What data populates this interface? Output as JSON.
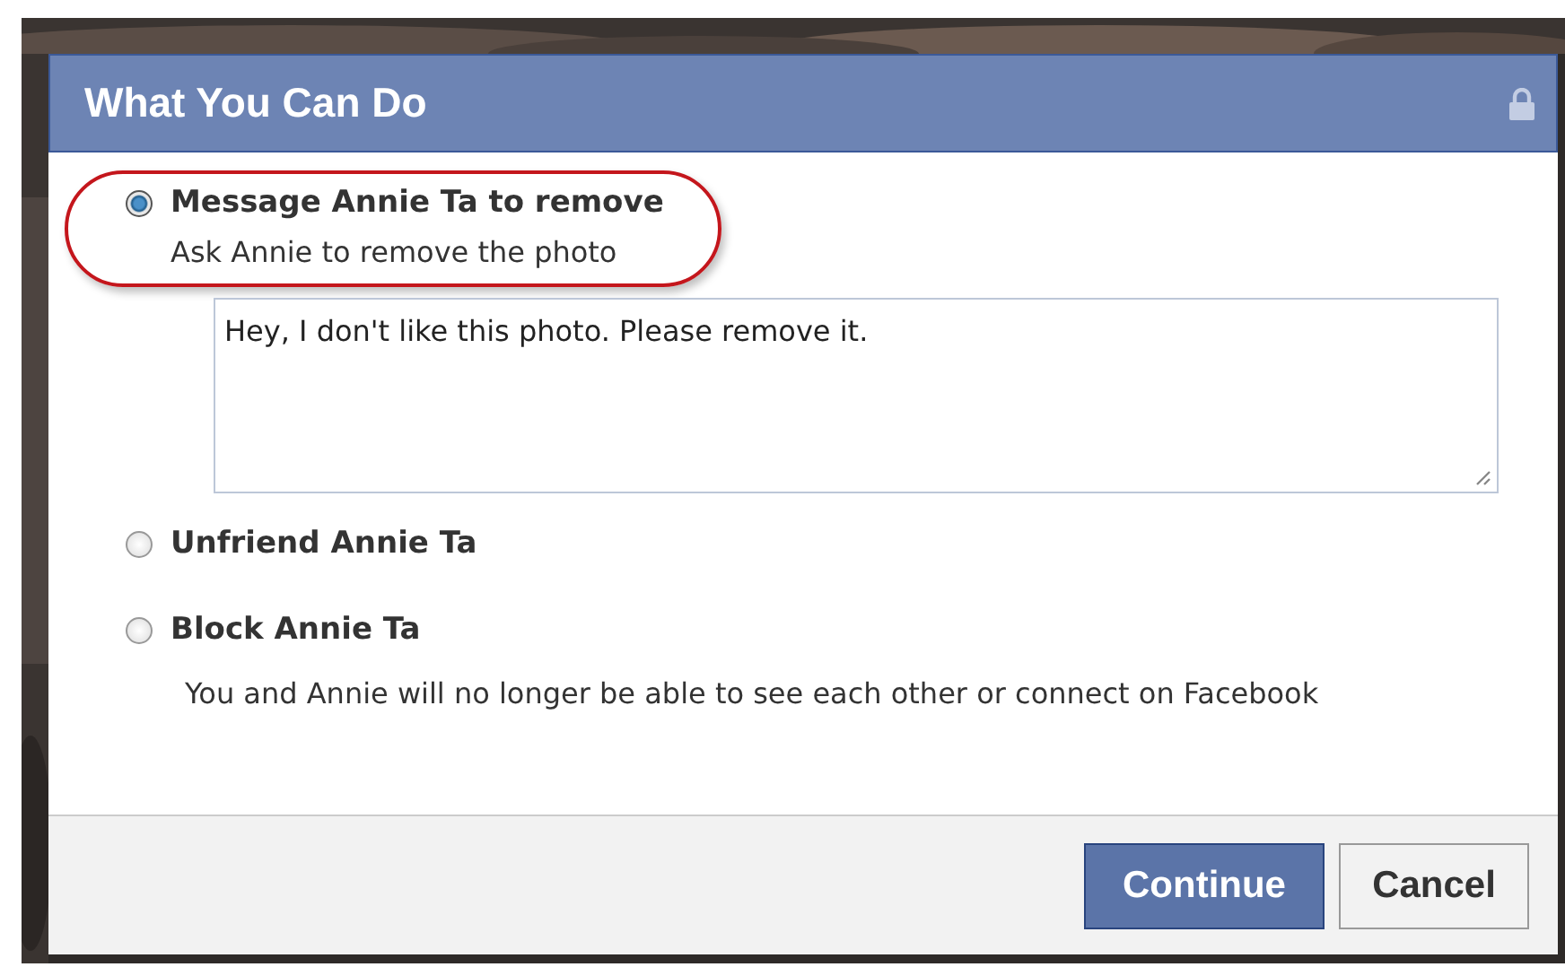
{
  "dialog": {
    "title": "What You Can Do",
    "locked": true
  },
  "options": [
    {
      "label": "Message Annie Ta to remove",
      "selected": true,
      "circled": true,
      "description": "Ask Annie to remove the photo",
      "message": "Hey, I don't like this photo. Please remove it."
    },
    {
      "label": "Unfriend Annie Ta",
      "selected": false,
      "circled": false
    },
    {
      "label": "Block Annie Ta",
      "selected": false,
      "circled": false,
      "description": "You and Annie will no longer be able to see each other or connect on Facebook"
    }
  ],
  "buttons": [
    {
      "label": "Continue",
      "kind": "primary"
    },
    {
      "label": "Cancel",
      "kind": "secondary"
    }
  ]
}
